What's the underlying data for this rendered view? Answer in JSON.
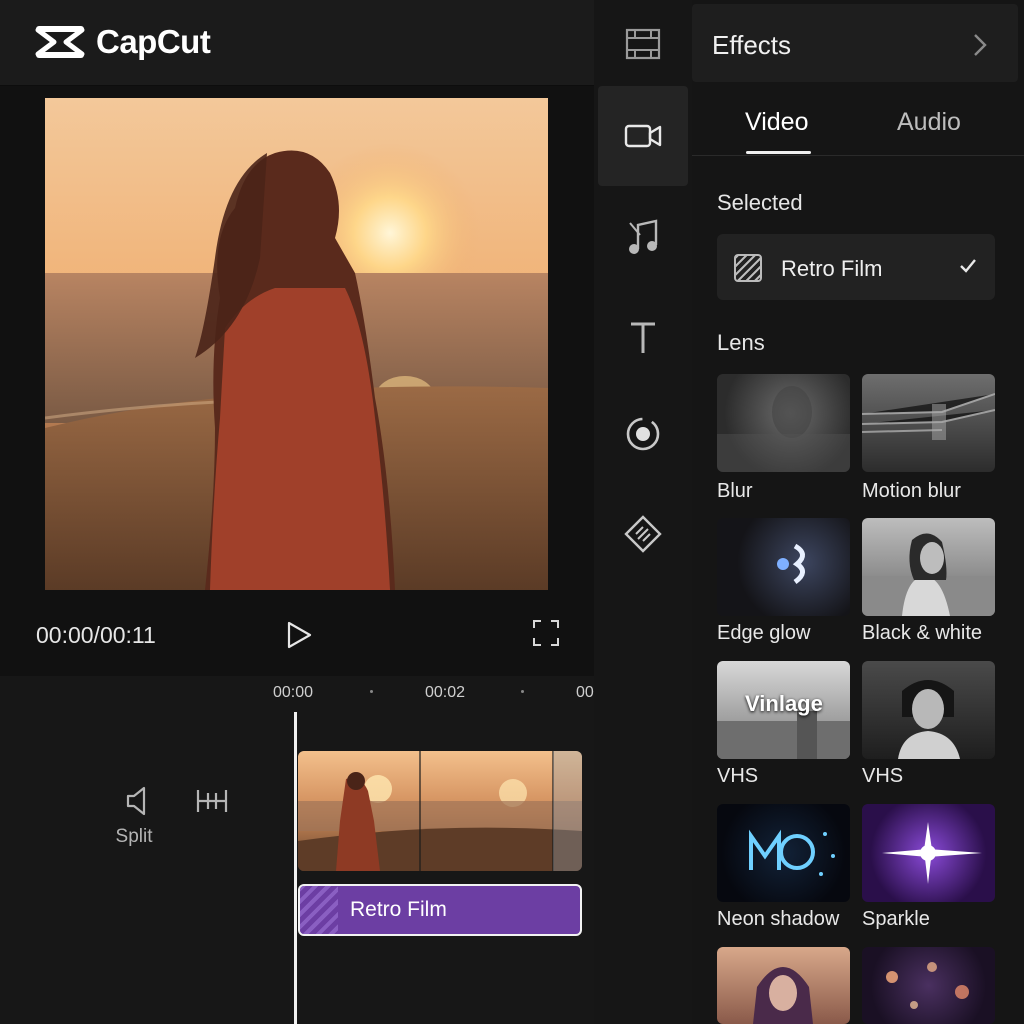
{
  "app": {
    "name": "CapCut"
  },
  "player": {
    "time_readout": "00:00/00:11",
    "play_icon": "play-icon",
    "fullscreen_icon": "fullscreen-icon"
  },
  "timeline": {
    "ticks": [
      "00:00",
      "00:02",
      "00"
    ],
    "tools": {
      "volume_icon": "speaker-icon",
      "split_label": "Split",
      "split_icon": "split-icon"
    },
    "effect_track_label": "Retro Film"
  },
  "rail": {
    "items": [
      "frame-icon",
      "video-camera-icon",
      "music-note-icon",
      "text-icon",
      "sticker-icon",
      "filter-icon"
    ],
    "active_index": 1
  },
  "panel": {
    "title": "Effects",
    "tabs": [
      {
        "label": "Video",
        "active": true
      },
      {
        "label": "Audio",
        "active": false
      }
    ],
    "selected_section": "Selected",
    "selected_effect": "Retro Film",
    "lens_section": "Lens",
    "effects": [
      {
        "label": "Blur"
      },
      {
        "label": "Motion blur"
      },
      {
        "label": "Edge glow"
      },
      {
        "label": "Black & white"
      },
      {
        "label": "VHS",
        "overlay": "Vinlage"
      },
      {
        "label": "VHS"
      },
      {
        "label": "Neon shadow"
      },
      {
        "label": "Sparkle"
      },
      {
        "label": ""
      },
      {
        "label": ""
      }
    ]
  },
  "colors": {
    "accent_purple": "#6c3ea3",
    "background": "#141414"
  }
}
